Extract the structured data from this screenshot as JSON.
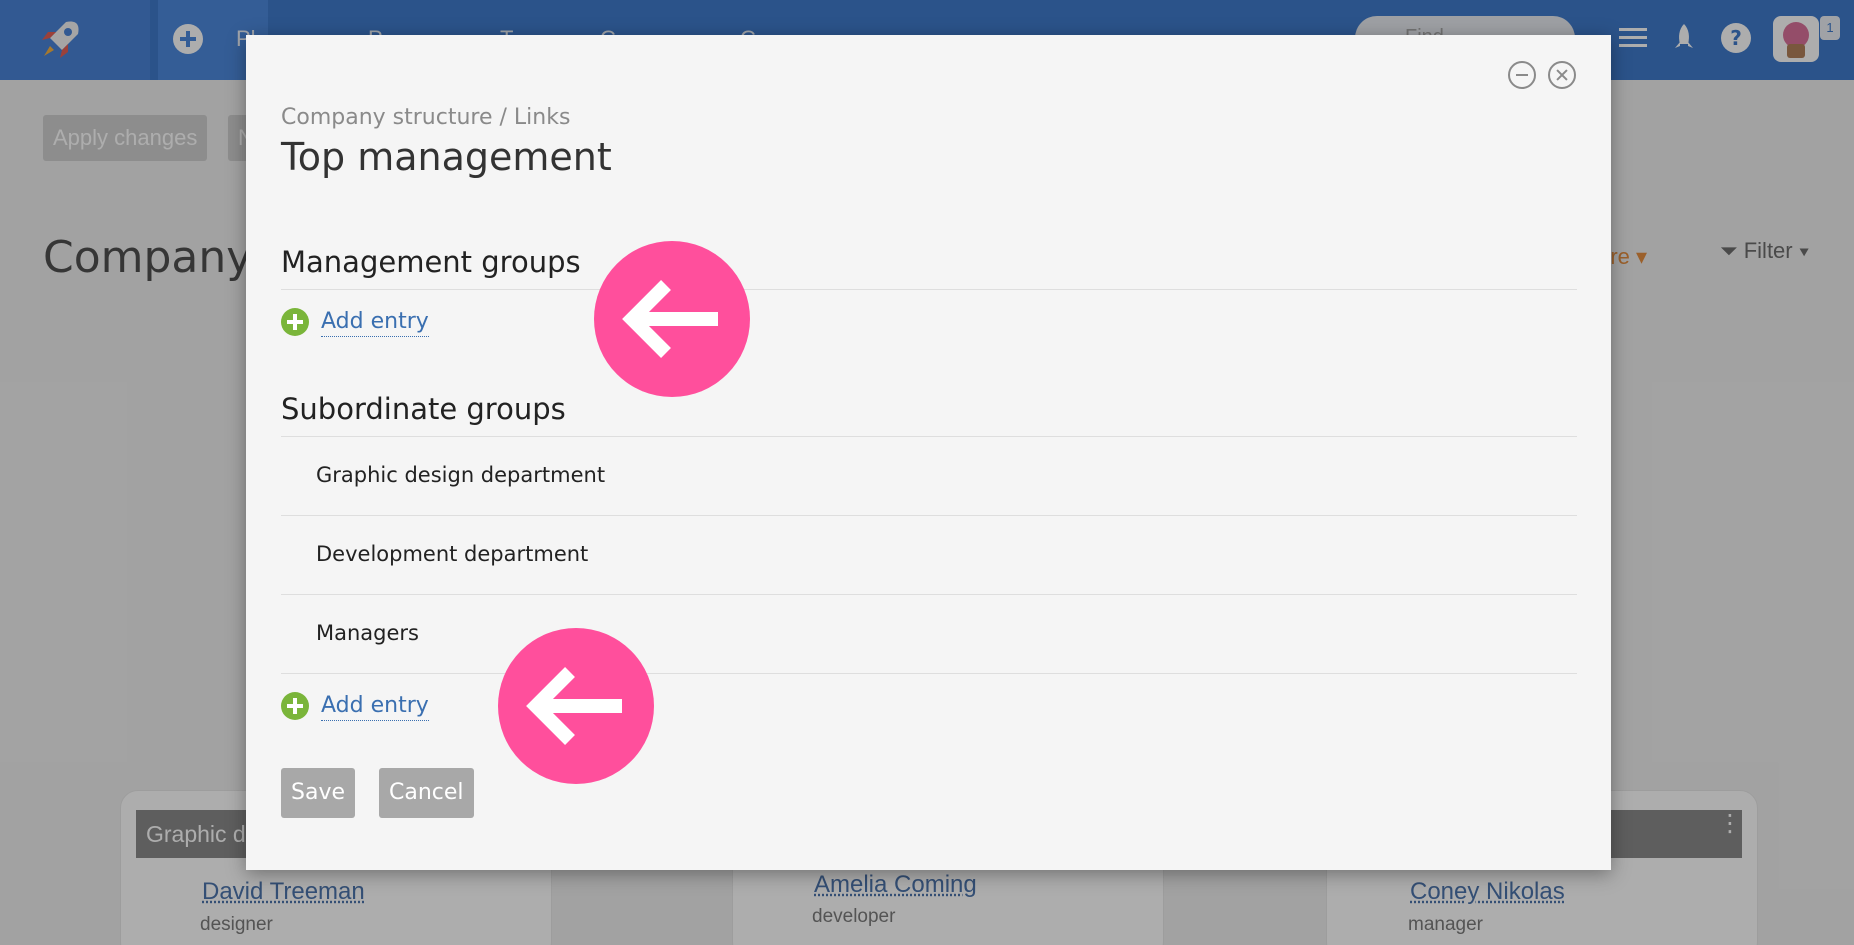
{
  "topbar": {
    "nav_fragments": [
      "Pl",
      "P",
      "T",
      "C",
      "C"
    ],
    "search_placeholder": "Find",
    "notification_count": "1"
  },
  "background": {
    "apply_button": "Apply changes",
    "second_button": "N",
    "page_title": "Company",
    "structure_link": "ture",
    "filter_link": "Filter",
    "card_header": "Graphic d",
    "people": [
      {
        "name": "David Treeman",
        "role": "designer"
      },
      {
        "name": "Amelia Coming",
        "role": "developer"
      },
      {
        "name": "Coney Nikolas",
        "role": "manager"
      }
    ]
  },
  "modal": {
    "breadcrumb": "Company structure / Links",
    "title": "Top management",
    "management_section": {
      "heading": "Management groups",
      "add_label": "Add entry"
    },
    "subordinate_section": {
      "heading": "Subordinate groups",
      "items": [
        "Graphic design department",
        "Development department",
        "Managers"
      ],
      "add_label": "Add entry"
    },
    "save_label": "Save",
    "cancel_label": "Cancel"
  },
  "colors": {
    "topbar": "#1f64c3",
    "highlight_badge": "#ff4f9c",
    "add_icon": "#7ab53a",
    "link": "#3a6fb0"
  }
}
